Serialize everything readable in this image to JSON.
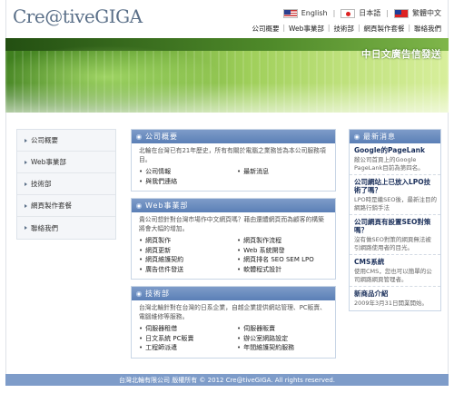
{
  "header": {
    "logo": "Cre@tiveGIGA",
    "languages": [
      {
        "icon": "us-flag-icon",
        "label": "English"
      },
      {
        "icon": "japan-flag-icon",
        "label": "日本語"
      },
      {
        "icon": "taiwan-flag-icon",
        "label": "繁體中文"
      }
    ],
    "nav": [
      "公司概要",
      "Web事業部",
      "技術部",
      "網頁製作套餐",
      "聯絡我們"
    ]
  },
  "banner": {
    "slogan": "中日文廣告信發送"
  },
  "sidebar": {
    "items": [
      "公司概要",
      "Web事業部",
      "技術部",
      "網頁製作套餐",
      "聯絡我們"
    ]
  },
  "sections": [
    {
      "title": "公司概要",
      "intro": "北輪在台灣已有21年歷史，所有有關於電腦之業務皆為本公司服務項目。",
      "links": [
        "公司情報",
        "最新消息",
        "與我們連絡",
        ""
      ]
    },
    {
      "title": "Web事業部",
      "intro": "貴公司想針對台灣市場作中文網頁嗎？藉由還體網頁而為顧客的構築將會大幅的增加。",
      "links": [
        "網頁製作",
        "網頁製作流程",
        "網頁更新",
        "Web 系統開發",
        "網頁維護契約",
        "網頁排名 SEO SEM LPO",
        "廣告信件發送",
        "軟體程式設計"
      ]
    },
    {
      "title": "技術部",
      "intro": "台灣北輪針對在台灣的日系企業，自越企業提供網站管理、PC販賣、電腦維修等服務。",
      "links": [
        "伺服器租借",
        "伺服器販賣",
        "日文系統 PC販賣",
        "辦公室網路設定",
        "工程師派遣",
        "年間維護契約服務"
      ]
    }
  ],
  "news": {
    "title": "最新消息",
    "items": [
      {
        "title": "Google的PageLank",
        "desc": "敝公司首頁上的Google PageLank目前為第四名。"
      },
      {
        "title": "公司網站上已放入LPO技術了嗎？",
        "desc": "LPO時是繼SEO後，最新注目的網路行銷手法"
      },
      {
        "title": "公司網頁有設置SEO對策嗎？",
        "desc": "沒有做SEO對策的網頁無法被引網路使用者的目光。"
      },
      {
        "title": "CMS系統",
        "desc": "使用CMS，您也可以簡單的公司網路網頁管理者。"
      },
      {
        "title": "新商品介紹",
        "desc": "2009年3月31日開業開始。"
      }
    ]
  },
  "footer": {
    "text": "台灣北輪有限公司 版權所有 © 2012 Cre@tiveGIGA. All rights reserved."
  },
  "colors": {
    "accent": "#5b7fb6",
    "banner_green": "#6ca93a",
    "footer": "#7e9cc9"
  }
}
